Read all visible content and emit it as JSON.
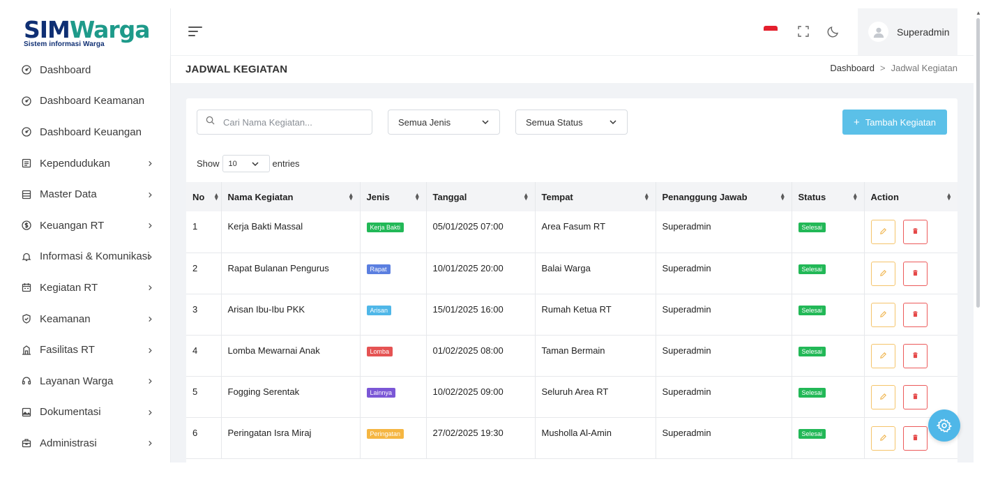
{
  "brand": {
    "name_part1": "SIM",
    "name_part2": "Warga",
    "tagline": "Sistem informasi Warga",
    "color_primary": "#0f2f73",
    "color_accent": "#1e9a8a"
  },
  "sidebar": {
    "items": [
      {
        "label": "Dashboard",
        "icon": "gauge-icon",
        "chevron": false
      },
      {
        "label": "Dashboard Keamanan",
        "icon": "gauge-icon",
        "chevron": false
      },
      {
        "label": "Dashboard Keuangan",
        "icon": "gauge-icon",
        "chevron": false
      },
      {
        "label": "Kependudukan",
        "icon": "id-card-icon",
        "chevron": true
      },
      {
        "label": "Master Data",
        "icon": "database-icon",
        "chevron": true
      },
      {
        "label": "Keuangan RT",
        "icon": "money-circle-icon",
        "chevron": true
      },
      {
        "label": "Informasi & Komunikasi",
        "icon": "bell-icon",
        "chevron": true
      },
      {
        "label": "Kegiatan RT",
        "icon": "calendar-icon",
        "chevron": true
      },
      {
        "label": "Keamanan",
        "icon": "shield-icon",
        "chevron": true
      },
      {
        "label": "Fasilitas RT",
        "icon": "building-icon",
        "chevron": true
      },
      {
        "label": "Layanan Warga",
        "icon": "headset-icon",
        "chevron": true
      },
      {
        "label": "Dokumentasi",
        "icon": "image-icon",
        "chevron": true
      },
      {
        "label": "Administrasi",
        "icon": "briefcase-icon",
        "chevron": true
      }
    ]
  },
  "header": {
    "username": "Superadmin"
  },
  "page": {
    "title": "JADWAL KEGIATAN",
    "breadcrumb": {
      "home": "Dashboard",
      "separator": ">",
      "current": "Jadwal Kegiatan"
    }
  },
  "filters": {
    "search_placeholder": "Cari Nama Kegiatan...",
    "jenis": "Semua Jenis",
    "status": "Semua Status",
    "add_button": "Tambah Kegiatan",
    "add_button_color": "#5bc0e8"
  },
  "entries": {
    "show": "Show",
    "value": "10",
    "suffix": "entries"
  },
  "table": {
    "columns": [
      "No",
      "Nama Kegiatan",
      "Jenis",
      "Tanggal",
      "Tempat",
      "Penanggung Jawab",
      "Status",
      "Action"
    ],
    "rows": [
      {
        "no": "1",
        "nama": "Kerja Bakti Massal",
        "jenis": "Kerja Bakti",
        "jenis_color": "#22b857",
        "tanggal": "05/01/2025 07:00",
        "tempat": "Area Fasum RT",
        "pj": "Superadmin",
        "status": "Selesai"
      },
      {
        "no": "2",
        "nama": "Rapat Bulanan Pengurus",
        "jenis": "Rapat",
        "jenis_color": "#5b7fe0",
        "tanggal": "10/01/2025 20:00",
        "tempat": "Balai Warga",
        "pj": "Superadmin",
        "status": "Selesai"
      },
      {
        "no": "3",
        "nama": "Arisan Ibu-Ibu PKK",
        "jenis": "Arisan",
        "jenis_color": "#4fb7e8",
        "tanggal": "15/01/2025 16:00",
        "tempat": "Rumah Ketua RT",
        "pj": "Superadmin",
        "status": "Selesai"
      },
      {
        "no": "4",
        "nama": "Lomba Mewarnai Anak",
        "jenis": "Lomba",
        "jenis_color": "#e55353",
        "tanggal": "01/02/2025 08:00",
        "tempat": "Taman Bermain",
        "pj": "Superadmin",
        "status": "Selesai"
      },
      {
        "no": "5",
        "nama": "Fogging Serentak",
        "jenis": "Lainnya",
        "jenis_color": "#7b57d6",
        "tanggal": "10/02/2025 09:00",
        "tempat": "Seluruh Area RT",
        "pj": "Superadmin",
        "status": "Selesai"
      },
      {
        "no": "6",
        "nama": "Peringatan Isra Miraj",
        "jenis": "Peringatan",
        "jenis_color": "#f5b642",
        "tanggal": "27/02/2025 19:30",
        "tempat": "Musholla Al-Amin",
        "pj": "Superadmin",
        "status": "Selesai"
      }
    ]
  }
}
